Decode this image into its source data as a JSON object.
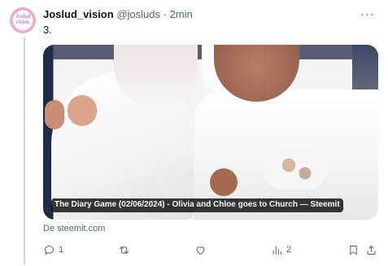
{
  "author": {
    "name": "Joslud_vision",
    "handle": "@josluds",
    "separator": "·",
    "time": "2min",
    "avatar_text": "Joslud vision"
  },
  "more_label": "···",
  "tweet_text": "3.",
  "card": {
    "caption": "The Diary Game (02/06/2024) - Olivia and Chloe goes to Church — Steemit",
    "source": "De steemit.com"
  },
  "actions": {
    "reply_count": "1",
    "views_count": "2"
  },
  "icons": {
    "reply": "reply-icon",
    "retweet": "retweet-icon",
    "like": "like-icon",
    "views": "views-icon",
    "bookmark": "bookmark-icon",
    "share": "share-icon"
  },
  "colors": {
    "text_primary": "#0f1419",
    "text_secondary": "#536471",
    "thread_line": "#cfd9de"
  }
}
